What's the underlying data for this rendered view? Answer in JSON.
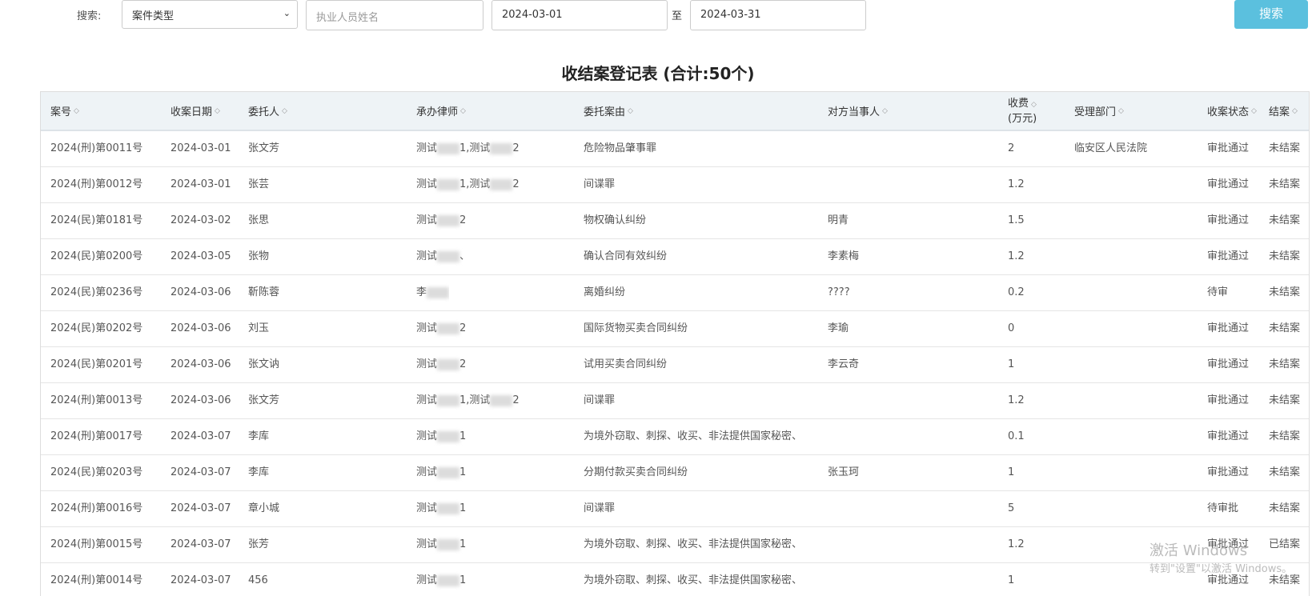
{
  "search": {
    "label": "搜索:",
    "case_type_selected": "案件类型",
    "lawyer_name_placeholder": "执业人员姓名",
    "start_date": "2024-03-01",
    "to_label": "至",
    "end_date": "2024-03-31",
    "button_label": "搜索"
  },
  "title": "收结案登记表 (合计:50个)",
  "columns": [
    {
      "label": "案号"
    },
    {
      "label": "收案日期"
    },
    {
      "label": "委托人"
    },
    {
      "label": "承办律师"
    },
    {
      "label": "委托案由"
    },
    {
      "label": "对方当事人"
    },
    {
      "label": "收费",
      "sub": "(万元)"
    },
    {
      "label": "受理部门"
    },
    {
      "label": "收案状态"
    },
    {
      "label": "结案"
    }
  ],
  "rows": [
    {
      "case_no": "2024(刑)第0011号",
      "date": "2024-03-01",
      "client": "张文芳",
      "lawyer_pre": "测试",
      "lawyer_mid": "1,测试",
      "lawyer_post": "2",
      "cause": "危险物品肇事罪",
      "opponent": "",
      "fee": "2",
      "dept": "临安区人民法院",
      "status": "审批通过",
      "closed": "未结案"
    },
    {
      "case_no": "2024(刑)第0012号",
      "date": "2024-03-01",
      "client": "张芸",
      "lawyer_pre": "测试",
      "lawyer_mid": "1,测试",
      "lawyer_post": "2",
      "cause": "间谍罪",
      "opponent": "",
      "fee": "1.2",
      "dept": "",
      "status": "审批通过",
      "closed": "未结案"
    },
    {
      "case_no": "2024(民)第0181号",
      "date": "2024-03-02",
      "client": "张思",
      "lawyer_pre": "测试",
      "lawyer_mid": "",
      "lawyer_post": "2",
      "cause": "物权确认纠纷",
      "opponent": "明青",
      "fee": "1.5",
      "dept": "",
      "status": "审批通过",
      "closed": "未结案"
    },
    {
      "case_no": "2024(民)第0200号",
      "date": "2024-03-05",
      "client": "张物",
      "lawyer_pre": "测试",
      "lawyer_mid": "",
      "lawyer_post": "、",
      "cause": "确认合同有效纠纷",
      "opponent": "李素梅",
      "fee": "1.2",
      "dept": "",
      "status": "审批通过",
      "closed": "未结案"
    },
    {
      "case_no": "2024(民)第0236号",
      "date": "2024-03-06",
      "client": "靳陈蓉",
      "lawyer_pre": "李",
      "lawyer_mid": "",
      "lawyer_post": "",
      "cause": "离婚纠纷",
      "opponent": "????",
      "fee": "0.2",
      "dept": "",
      "status": "待审",
      "closed": "未结案"
    },
    {
      "case_no": "2024(民)第0202号",
      "date": "2024-03-06",
      "client": "刘玉",
      "lawyer_pre": "测试",
      "lawyer_mid": "",
      "lawyer_post": "2",
      "cause": "国际货物买卖合同纠纷",
      "opponent": "李瑜",
      "fee": "0",
      "dept": "",
      "status": "审批通过",
      "closed": "未结案"
    },
    {
      "case_no": "2024(民)第0201号",
      "date": "2024-03-06",
      "client": "张文讷",
      "lawyer_pre": "测试",
      "lawyer_mid": "",
      "lawyer_post": "2",
      "cause": "试用买卖合同纠纷",
      "opponent": "李云奇",
      "fee": "1",
      "dept": "",
      "status": "审批通过",
      "closed": "未结案"
    },
    {
      "case_no": "2024(刑)第0013号",
      "date": "2024-03-06",
      "client": "张文芳",
      "lawyer_pre": "测试",
      "lawyer_mid": "1,测试",
      "lawyer_post": "2",
      "cause": "间谍罪",
      "opponent": "",
      "fee": "1.2",
      "dept": "",
      "status": "审批通过",
      "closed": "未结案"
    },
    {
      "case_no": "2024(刑)第0017号",
      "date": "2024-03-07",
      "client": "李库",
      "lawyer_pre": "测试",
      "lawyer_mid": "",
      "lawyer_post": "1",
      "cause": "为境外窃取、刺探、收买、非法提供国家秘密、",
      "opponent": "",
      "fee": "0.1",
      "dept": "",
      "status": "审批通过",
      "closed": "未结案"
    },
    {
      "case_no": "2024(民)第0203号",
      "date": "2024-03-07",
      "client": "李库",
      "lawyer_pre": "测试",
      "lawyer_mid": "",
      "lawyer_post": "1",
      "cause": "分期付款买卖合同纠纷",
      "opponent": "张玉珂",
      "fee": "1",
      "dept": "",
      "status": "审批通过",
      "closed": "未结案"
    },
    {
      "case_no": "2024(刑)第0016号",
      "date": "2024-03-07",
      "client": "章小城",
      "lawyer_pre": "测试",
      "lawyer_mid": "",
      "lawyer_post": "1",
      "cause": "间谍罪",
      "opponent": "",
      "fee": "5",
      "dept": "",
      "status": "待审批",
      "closed": "未结案"
    },
    {
      "case_no": "2024(刑)第0015号",
      "date": "2024-03-07",
      "client": "张芳",
      "lawyer_pre": "测试",
      "lawyer_mid": "",
      "lawyer_post": "1",
      "cause": "为境外窃取、刺探、收买、非法提供国家秘密、",
      "opponent": "",
      "fee": "1.2",
      "dept": "",
      "status": "审批通过",
      "closed": "已结案"
    },
    {
      "case_no": "2024(刑)第0014号",
      "date": "2024-03-07",
      "client": "456",
      "lawyer_pre": "测试",
      "lawyer_mid": "",
      "lawyer_post": "1",
      "cause": "为境外窃取、刺探、收买、非法提供国家秘密、",
      "opponent": "",
      "fee": "1",
      "dept": "",
      "status": "审批通过",
      "closed": "未结案"
    }
  ],
  "watermark": {
    "line1": "激活 Windows",
    "line2": "转到\"设置\"以激活 Windows。"
  }
}
